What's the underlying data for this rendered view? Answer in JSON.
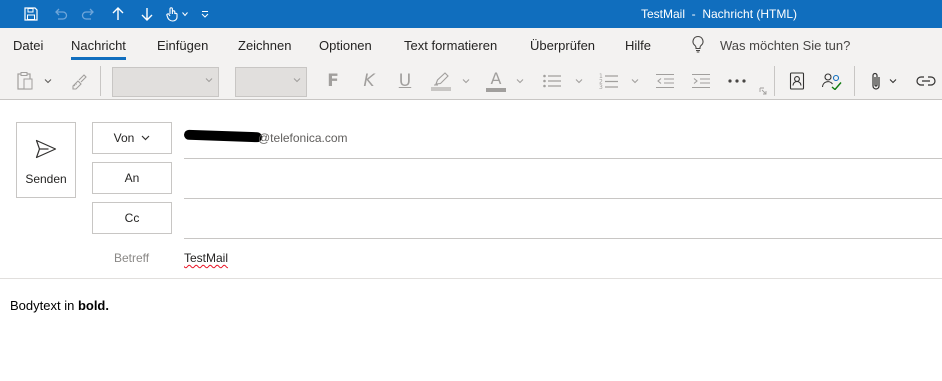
{
  "window": {
    "title": "TestMail  -  Nachricht (HTML)"
  },
  "quick_access": [
    "save-icon",
    "undo-icon",
    "redo-icon",
    "arrow-up-icon",
    "arrow-down-icon",
    "touch-mode-icon",
    "customize-qat-icon"
  ],
  "tabs": [
    {
      "label": "Datei",
      "active": false
    },
    {
      "label": "Nachricht",
      "active": true
    },
    {
      "label": "Einfügen",
      "active": false
    },
    {
      "label": "Zeichnen",
      "active": false
    },
    {
      "label": "Optionen",
      "active": false
    },
    {
      "label": "Text formatieren",
      "active": false
    },
    {
      "label": "Überprüfen",
      "active": false
    },
    {
      "label": "Hilfe",
      "active": false
    }
  ],
  "tell_me": {
    "label": "Was möchten Sie tun?"
  },
  "ribbon": {
    "bold_letter": "F",
    "italic_letter": "K",
    "underline_letter": "U",
    "font_color_letter": "A",
    "font_name": "",
    "font_size": ""
  },
  "compose": {
    "send_label": "Senden",
    "from_label": "Von",
    "from_value": "@telefonica.com",
    "to_label": "An",
    "cc_label": "Cc",
    "subject_label": "Betreff",
    "subject_value": "TestMail"
  },
  "body": {
    "text_prefix": "Bodytext in ",
    "text_bold": "bold."
  },
  "colors": {
    "titlebar": "#106ebe",
    "accent": "#106ebe",
    "ribbon_bg": "#f3f2f1",
    "highlight_bar": "#c8c6c4",
    "font_color_bar": "#a19f9d"
  }
}
